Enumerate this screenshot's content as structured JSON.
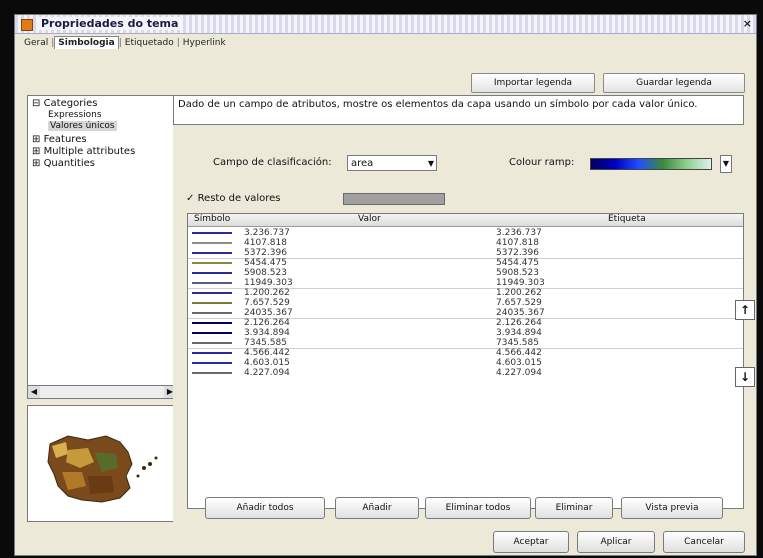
{
  "window": {
    "title": "Propriedades do tema"
  },
  "tabs": [
    {
      "label": "Geral"
    },
    {
      "label": "Simbologia"
    },
    {
      "label": "Etiquetado"
    },
    {
      "label": "Hyperlink"
    }
  ],
  "top_buttons": {
    "import": "Importar legenda",
    "save": "Guardar legenda"
  },
  "tree": {
    "categories": "Categories",
    "expressions": "Expressions",
    "unique_values": "Valores únicos",
    "features": "Features",
    "multiple_attributes": "Multiple attributes",
    "quantities": "Quantities"
  },
  "description": "Dado de un campo de atributos, mostre os elementos da capa usando un símbolo por cada valor único.",
  "classification": {
    "field_label": "Campo de clasificación:",
    "field_value": "area",
    "color_ramp_label": "Colour ramp:",
    "transparency_label": "Resto de valores"
  },
  "table": {
    "headers": {
      "symbol": "Símbolo",
      "value": "Valor",
      "label": "Etiqueta"
    },
    "rows": [
      {
        "value": "3.236.737",
        "label": "3.236.737",
        "color": "#2a2a9c"
      },
      {
        "value": "4107.818",
        "label": "4107.818",
        "color": "#8c8c8c"
      },
      {
        "value": "5372.396",
        "label": "5372.396",
        "color": "#2a2a9c"
      },
      {
        "value": "5454.475",
        "label": "5454.475",
        "color": "#8a8a3c"
      },
      {
        "value": "5908.523",
        "label": "5908.523",
        "color": "#2a2a9c"
      },
      {
        "value": "11949.303",
        "label": "11949.303",
        "color": "#5a5a8c"
      },
      {
        "value": "1.200.262",
        "label": "1.200.262",
        "color": "#2a2a9c"
      },
      {
        "value": "7.657.529",
        "label": "7.657.529",
        "color": "#7a7a3a"
      },
      {
        "value": "24035.367",
        "label": "24035.367",
        "color": "#6a6a6a"
      },
      {
        "value": "2.126.264",
        "label": "2.126.264",
        "color": "#000060"
      },
      {
        "value": "3.934.894",
        "label": "3.934.894",
        "color": "#000060"
      },
      {
        "value": "7345.585",
        "label": "7345.585",
        "color": "#6a6a6a"
      },
      {
        "value": "4.566.442",
        "label": "4.566.442",
        "color": "#2a2a9c"
      },
      {
        "value": "4.603.015",
        "label": "4.603.015",
        "color": "#2a2a9c"
      },
      {
        "value": "4.227.094",
        "label": "4.227.094",
        "color": "#6a6a6a"
      }
    ]
  },
  "bottom_buttons": {
    "add_all": "Añadir todos",
    "add": "Añadir",
    "remove_all": "Eliminar todos",
    "remove": "Eliminar",
    "preview": "Vista previa"
  },
  "dialog_buttons": {
    "accept": "Aceptar",
    "apply": "Aplicar",
    "cancel": "Cancelar"
  },
  "icons": {
    "up": "arrow-up-icon",
    "down": "arrow-down-icon",
    "window": "theme-icon"
  }
}
